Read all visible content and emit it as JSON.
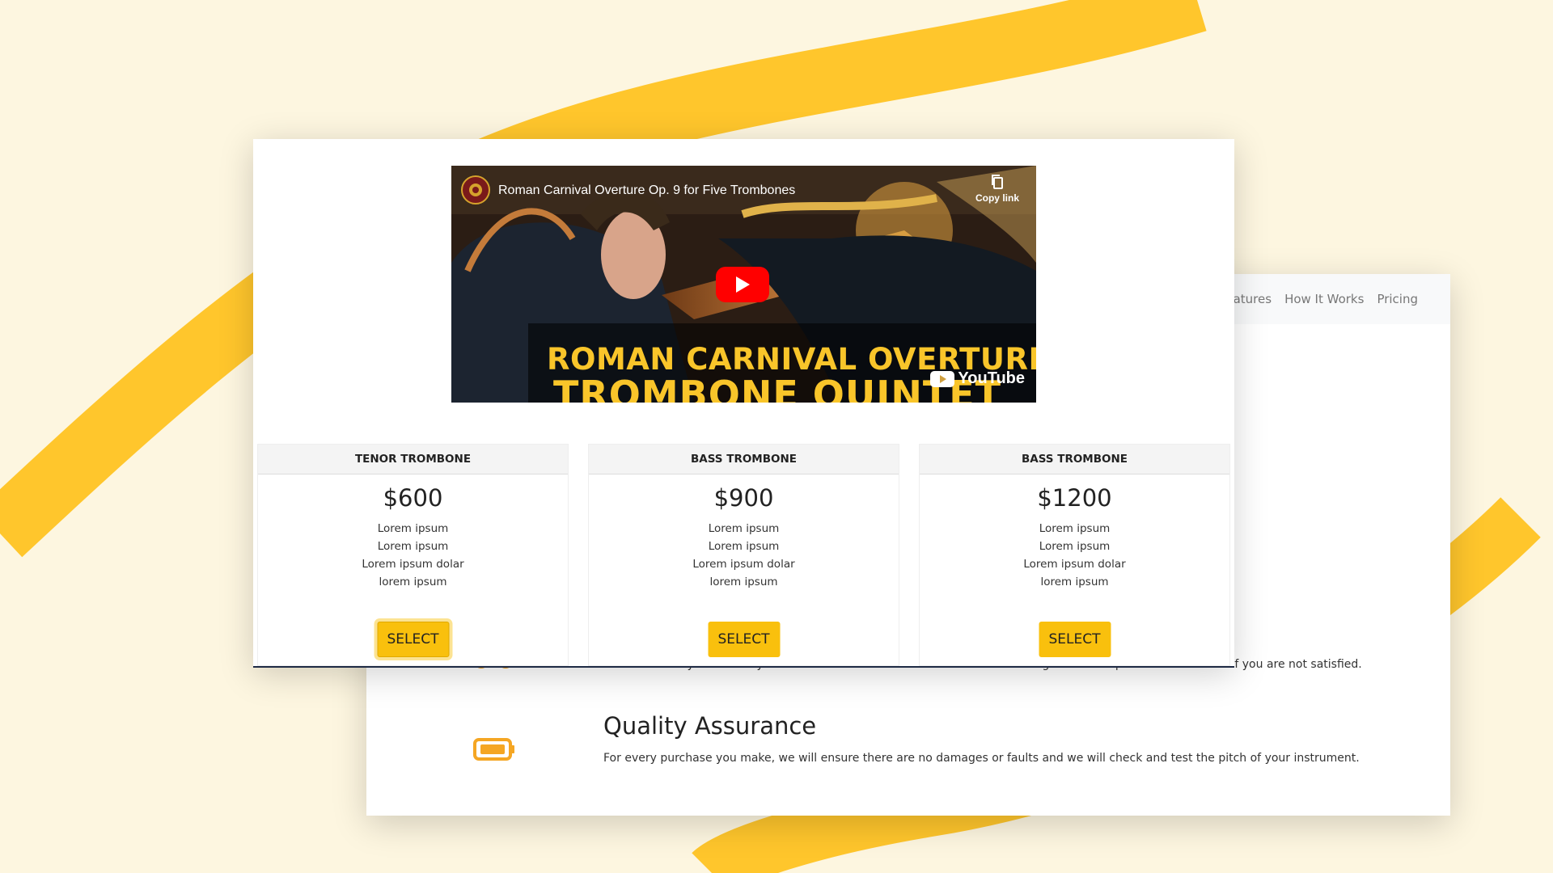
{
  "back_window": {
    "nav": {
      "items": [
        {
          "label": "atures"
        },
        {
          "label": "How It Works"
        },
        {
          "label": "Pricing"
        }
      ]
    },
    "features": [
      {
        "icon": "delivery-truck-icon",
        "title": "",
        "text": "We make sure you recieve your trombone as soon as we have finished making it. We also provide free returns if you are not satisfied."
      },
      {
        "icon": "battery-icon",
        "title": "Quality Assurance",
        "text": "For every purchase you make, we will ensure there are no damages or faults and we will check and test the pitch of your instrument."
      }
    ]
  },
  "video": {
    "title": "Roman Carnival Overture Op. 9 for Five Trombones",
    "copy_link_label": "Copy link",
    "overlay_line1": "ROMAN CARNIVAL OVERTURE",
    "overlay_line2": "TROMBONE QUINTET",
    "platform_label": "YouTube"
  },
  "pricing": {
    "cards": [
      {
        "name": "TENOR TROMBONE",
        "price": "$600",
        "features": [
          "Lorem ipsum",
          "Lorem ipsum",
          "Lorem ipsum dolar",
          "lorem ipsum"
        ],
        "button": "SELECT"
      },
      {
        "name": "BASS TROMBONE",
        "price": "$900",
        "features": [
          "Lorem ipsum",
          "Lorem ipsum",
          "Lorem ipsum dolar",
          "lorem ipsum"
        ],
        "button": "SELECT"
      },
      {
        "name": "BASS TROMBONE",
        "price": "$1200",
        "features": [
          "Lorem ipsum",
          "Lorem ipsum",
          "Lorem ipsum dolar",
          "lorem ipsum"
        ],
        "button": "SELECT"
      }
    ]
  },
  "colors": {
    "background": "#fdf6e0",
    "accent_yellow": "#ffc62c",
    "button": "#f9c00d",
    "youtube_red": "#ff0000"
  }
}
